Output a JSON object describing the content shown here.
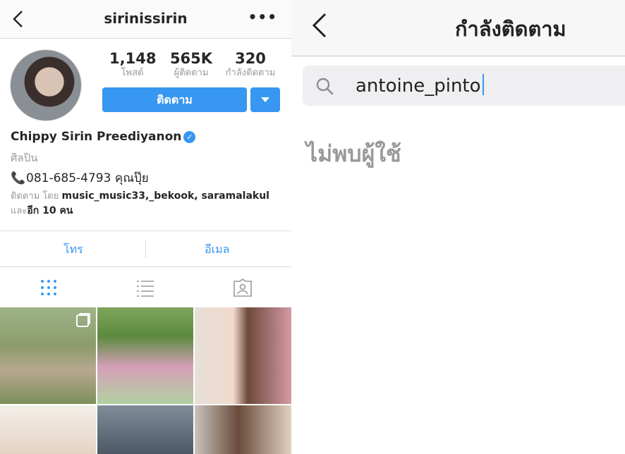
{
  "left": {
    "header": {
      "username": "sirinissirin",
      "more": "•••"
    },
    "stats": [
      {
        "value": "1,148",
        "label": "โพสต์"
      },
      {
        "value": "565K",
        "label": "ผู้ติดตาม"
      },
      {
        "value": "320",
        "label": "กำลังติดตาม"
      }
    ],
    "follow_label": "ติดตาม",
    "profile": {
      "full_name": "Chippy Sirin Preediyanon",
      "verified_mark": "✓",
      "category": "ศิลปิน",
      "bio_line": "081-685-4793 คุณปุ๊ย",
      "phone_glyph": "📞",
      "followed_by_prefix": "ติดตาม โดย",
      "followed_by_names": "music_music33,_bekook, saramalakul",
      "followed_by_more_prefix": "และ",
      "followed_by_more": "อีก 10 คน"
    },
    "contact": {
      "call": "โทร",
      "email": "อีเมล"
    },
    "tabs": [
      "grid-icon",
      "list-icon",
      "tagged-icon"
    ],
    "accent": "#3897f0"
  },
  "right": {
    "header": {
      "title": "กำลังติดตาม"
    },
    "search": {
      "value": "antoine_pinto"
    },
    "empty_message": "ไม่พบผู้ใช้"
  }
}
